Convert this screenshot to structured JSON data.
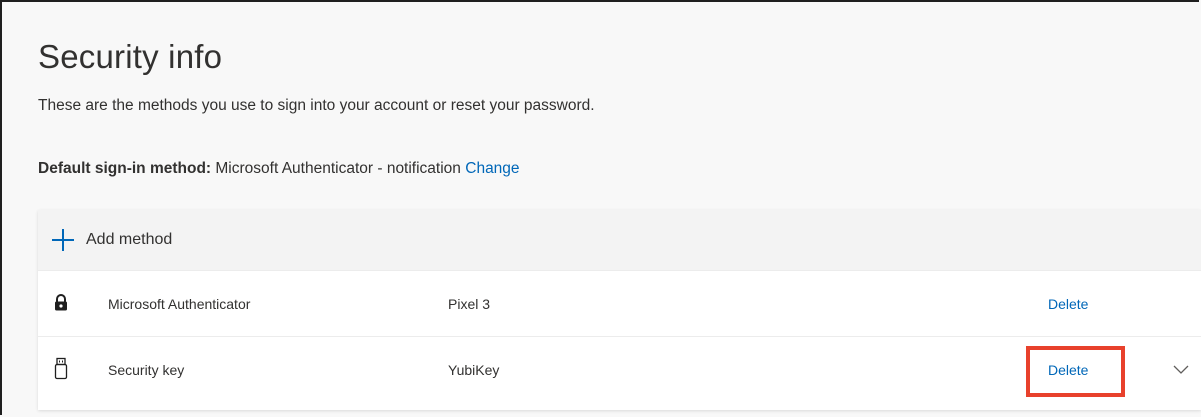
{
  "page": {
    "title": "Security info",
    "subtitle": "These are the methods you use to sign into your account or reset your password.",
    "default_label": "Default sign-in method:",
    "default_value": "Microsoft Authenticator - notification",
    "change_link": "Change"
  },
  "panel": {
    "add_method_label": "Add method",
    "methods": [
      {
        "icon": "lock-icon",
        "name": "Microsoft Authenticator",
        "detail": "Pixel 3",
        "action": "Delete"
      },
      {
        "icon": "usb-key-icon",
        "name": "Security key",
        "detail": "YubiKey",
        "action": "Delete"
      }
    ]
  },
  "colors": {
    "link": "#0067b8",
    "highlight": "#e8412c",
    "background": "#f8f8f8"
  }
}
